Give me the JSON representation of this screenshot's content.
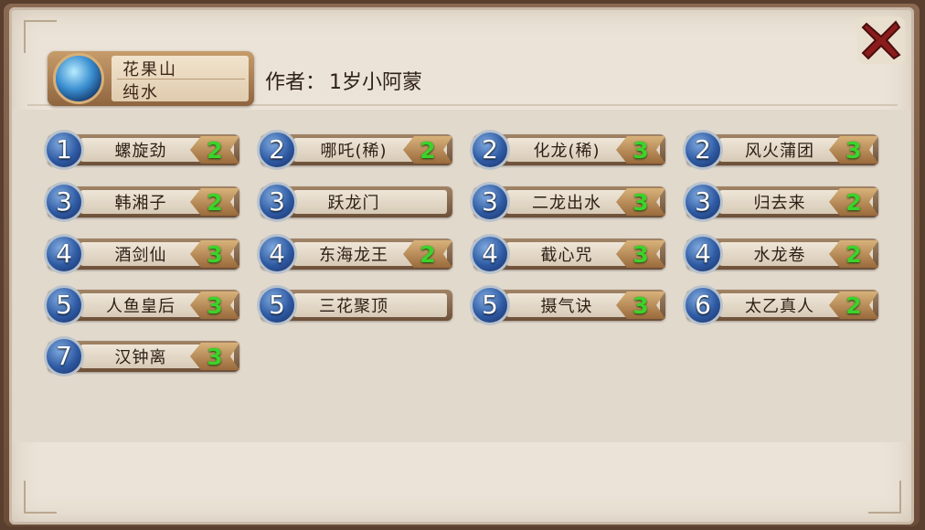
{
  "hero": {
    "name": "花果山",
    "school": "纯水",
    "avatar_icon": "hero-portrait-icon"
  },
  "author": {
    "label": "作者：",
    "value": "1岁小阿蒙"
  },
  "close_icon": "close-x-icon",
  "cards": [
    {
      "order": "1",
      "name": "螺旋劲",
      "cost": "2"
    },
    {
      "order": "2",
      "name": "哪吒(稀)",
      "cost": "2"
    },
    {
      "order": "2",
      "name": "化龙(稀)",
      "cost": "3"
    },
    {
      "order": "2",
      "name": "风火蒲团",
      "cost": "3"
    },
    {
      "order": "3",
      "name": "韩湘子",
      "cost": "2"
    },
    {
      "order": "3",
      "name": "跃龙门",
      "cost": ""
    },
    {
      "order": "3",
      "name": "二龙出水",
      "cost": "3"
    },
    {
      "order": "3",
      "name": "归去来",
      "cost": "2"
    },
    {
      "order": "4",
      "name": "酒剑仙",
      "cost": "3"
    },
    {
      "order": "4",
      "name": "东海龙王",
      "cost": "2"
    },
    {
      "order": "4",
      "name": "截心咒",
      "cost": "3"
    },
    {
      "order": "4",
      "name": "水龙卷",
      "cost": "2"
    },
    {
      "order": "5",
      "name": "人鱼皇后",
      "cost": "3"
    },
    {
      "order": "5",
      "name": "三花聚顶",
      "cost": ""
    },
    {
      "order": "5",
      "name": "摄气诀",
      "cost": "3"
    },
    {
      "order": "6",
      "name": "太乙真人",
      "cost": "2"
    },
    {
      "order": "7",
      "name": "汉钟离",
      "cost": "3"
    }
  ],
  "colors": {
    "cost_text": "#3bd32a",
    "order_badge": "#2e5aa3",
    "panel": "#ebe3d7"
  }
}
